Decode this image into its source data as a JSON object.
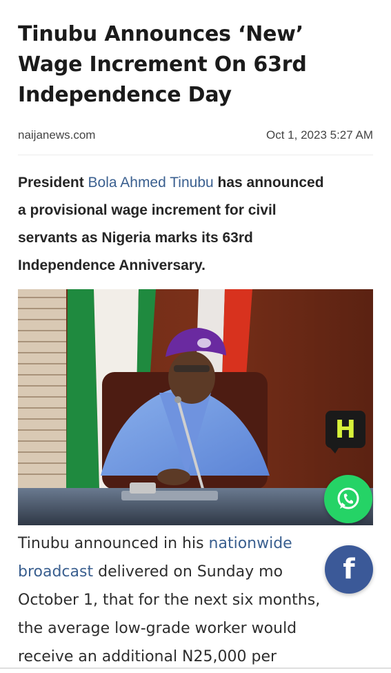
{
  "article": {
    "title_lines": [
      "Tinubu Announces ‘New’",
      "Wage Increment On 63rd",
      "Independence Day"
    ],
    "source": "naijanews.com",
    "date": "Oct 1, 2023 5:27 AM",
    "lead": {
      "before": "President ",
      "link": "Bola Ahmed Tinubu",
      "after_lines": [
        " has announced",
        "a provisional wage increment for civil",
        "servants as Nigeria marks its 63rd",
        "Independence Anniversary."
      ]
    },
    "body": {
      "line1_before": "Tinubu announced in his ",
      "line1_link": "nationwide",
      "line2_link": "broadcast",
      "line2_after": " delivered on Sunday mo",
      "line3": "October 1, that for the next six months,",
      "line4": "the average low-grade worker would",
      "line5": "receive an additional N25,000 per"
    }
  },
  "photo": {
    "logo_letter": "H"
  },
  "share": {
    "whatsapp_icon": "whatsapp-icon",
    "facebook_icon": "facebook-icon",
    "facebook_glyph": "f"
  },
  "colors": {
    "link": "#3a5f8f",
    "whatsapp": "#25d366",
    "facebook": "#3b5998"
  }
}
